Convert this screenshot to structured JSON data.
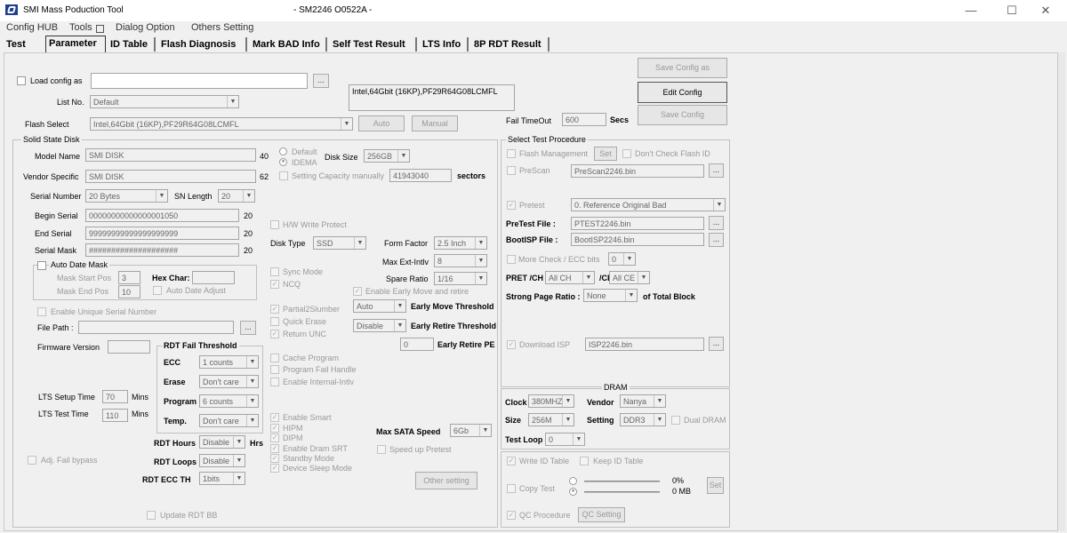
{
  "window": {
    "title": "SMI Mass Poduction Tool",
    "subtitle": "- SM2246 O0522A -",
    "min": "—",
    "max": "☐",
    "close": "✕"
  },
  "menu": [
    "Config HUB",
    "Tools",
    "Dialog Option",
    "Others Setting"
  ],
  "tabs": [
    "Test",
    "Parameter",
    "ID Table",
    "Flash Diagnosis",
    "Mark BAD Info",
    "Self Test Result",
    "LTS Info",
    "8P RDT Result"
  ],
  "top": {
    "load_config_label": "Load config as",
    "load_config_value": "",
    "browse": "...",
    "list_no_label": "List No.",
    "list_no_value": "Default",
    "flash_info": "Intel,64Gbit (16KP),PF29R64G08LCMFL",
    "flash_select_label": "Flash Select",
    "flash_select_value": "Intel,64Gbit (16KP),PF29R64G08LCMFL",
    "auto_btn": "Auto",
    "manual_btn": "Manual",
    "save_config_as": "Save Config as",
    "edit_config": "Edit Config",
    "save_config": "Save Config",
    "fail_timeout_label": "Fail TimeOut",
    "fail_timeout_value": "600",
    "secs": "Secs"
  },
  "ssd": {
    "title": "Solid State Disk",
    "model_name_label": "Model Name",
    "model_name_value": "SMI DISK",
    "model_len": "40",
    "vendor_label": "Vendor Specific",
    "vendor_value": "SMI DISK",
    "vendor_len": "62",
    "mode_default": "Default",
    "mode_idema": "IDEMA",
    "disk_size_label": "Disk Size",
    "disk_size_value": "256GB",
    "setting_capacity": "Setting Capacity manually",
    "capacity_value": "41943040",
    "sectors": "sectors",
    "serial_number_label": "Serial Number",
    "serial_number_value": "20 Bytes",
    "sn_length_label": "SN Length",
    "sn_length_value": "20",
    "begin_serial_label": "Begin Serial",
    "begin_serial_value": "00000000000000001050",
    "begin_len": "20",
    "end_serial_label": "End Serial",
    "end_serial_value": "99999999999999999999",
    "end_len": "20",
    "serial_mask_label": "Serial Mask",
    "serial_mask_value": "####################",
    "mask_len": "20",
    "auto_date_mask": "Auto Date Mask",
    "mask_start_label": "Mask Start Pos",
    "mask_start_value": "3",
    "hex_char_label": "Hex Char:",
    "mask_end_label": "Mask End Pos",
    "mask_end_value": "10",
    "auto_date_adjust": "Auto Date Adjust",
    "enable_unique": "Enable Unique Serial Number",
    "file_path_label": "File Path :",
    "firmware_version_label": "Firmware Version",
    "hw_write_protect": "H/W Write Protect",
    "disk_type_label": "Disk Type",
    "disk_type_value": "SSD",
    "form_factor_label": "Form Factor",
    "form_factor_value": "2.5 Inch",
    "max_ext_label": "Max Ext-Intlv",
    "max_ext_value": "8",
    "spare_ratio_label": "Spare Ratio",
    "spare_ratio_value": "1/16",
    "sync_mode": "Sync Mode",
    "ncq": "NCQ",
    "early_move_retire": "Enable Early Move and retire",
    "partial2slumber": "Partial2Slumber",
    "quick_erase": "Quick Erase",
    "return_unc": "Return UNC",
    "early_move_sel": "Auto",
    "early_move_label": "Early Move Threshold",
    "early_retire_sel": "Disable",
    "early_retire_label": "Early Retire Threshold",
    "early_retire_pe_value": "0",
    "early_retire_pe_label": "Early Retire PE",
    "rdt_title": "RDT Fail Threshold",
    "ecc_label": "ECC",
    "ecc_value": "1 counts",
    "erase_label": "Erase",
    "erase_value": "Don't care",
    "program_label": "Program",
    "program_value": "6 counts",
    "temp_label": "Temp.",
    "temp_value": "Don't care",
    "cache_program": "Cache Program",
    "program_fail_handle": "Program Fail Handle",
    "enable_internal": "Enable Internal-Intlv",
    "lts_setup_label": "LTS Setup Time",
    "lts_setup_value": "70",
    "mins1": "Mins",
    "lts_test_label": "LTS Test Time",
    "lts_test_value": "110",
    "mins2": "Mins",
    "enable_smart": "Enable Smart",
    "hipm": "HIPM",
    "dipm": "DIPM",
    "enable_dram_srt": "Enable Dram SRT",
    "standby_mode": "Standby Mode",
    "device_sleep": "Device Sleep Mode",
    "max_sata_label": "Max SATA Speed",
    "max_sata_value": "6Gb",
    "speed_up_pretest": "Speed up Pretest",
    "rdt_hours_label": "RDT Hours",
    "rdt_hours_value": "Disable",
    "hrs": "Hrs",
    "rdt_loops_label": "RDT Loops",
    "rdt_loops_value": "Disable",
    "rdt_ecc_label": "RDT ECC TH",
    "rdt_ecc_value": "1bits",
    "adj_fail_bypass": "Adj. Fail bypass",
    "update_rdt_bb": "Update RDT BB",
    "other_setting": "Other setting"
  },
  "procedure": {
    "title": "Select Test Procedure",
    "flash_management": "Flash Management",
    "set_btn": "Set",
    "dont_check_flash_id": "Don't Check Flash ID",
    "prescan": "PreScan",
    "prescan_file": "PreScan2246.bin",
    "pretest": "Pretest",
    "pretest_value": "0. Reference Original Bad",
    "pretest_file_label": "PreTest File :",
    "pretest_file": "PTEST2246.bin",
    "bootisp_label": "BootISP File :",
    "bootisp_file": "BootISP2246.bin",
    "more_check": "More Check / ECC bits",
    "more_check_value": "0",
    "pret_ch_label": "PRET /CH",
    "pret_ch_value": "All CH",
    "ce_label": "/CE",
    "ce_value": "All CE",
    "strong_page_label": "Strong Page Ratio :",
    "strong_page_value": "None",
    "of_total": "of Total Block",
    "download_isp": "Download ISP",
    "isp_file": "ISP2246.bin"
  },
  "dram": {
    "title": "DRAM",
    "clock_label": "Clock",
    "clock_value": "380MHZ",
    "vendor_label": "Vendor",
    "vendor_value": "Nanya",
    "size_label": "Size",
    "size_value": "256M",
    "setting_label": "Setting",
    "setting_value": "DDR3",
    "dual_dram": "Dual DRAM",
    "test_loop_label": "Test Loop",
    "test_loop_value": "0"
  },
  "bottom_right": {
    "write_id_table": "Write ID Table",
    "keep_id_table": "Keep ID Table",
    "copy_test": "Copy Test",
    "percent": "0%",
    "mb": "0 MB",
    "set_btn": "Set",
    "qc_procedure": "QC Procedure",
    "qc_setting": "QC Setting"
  }
}
